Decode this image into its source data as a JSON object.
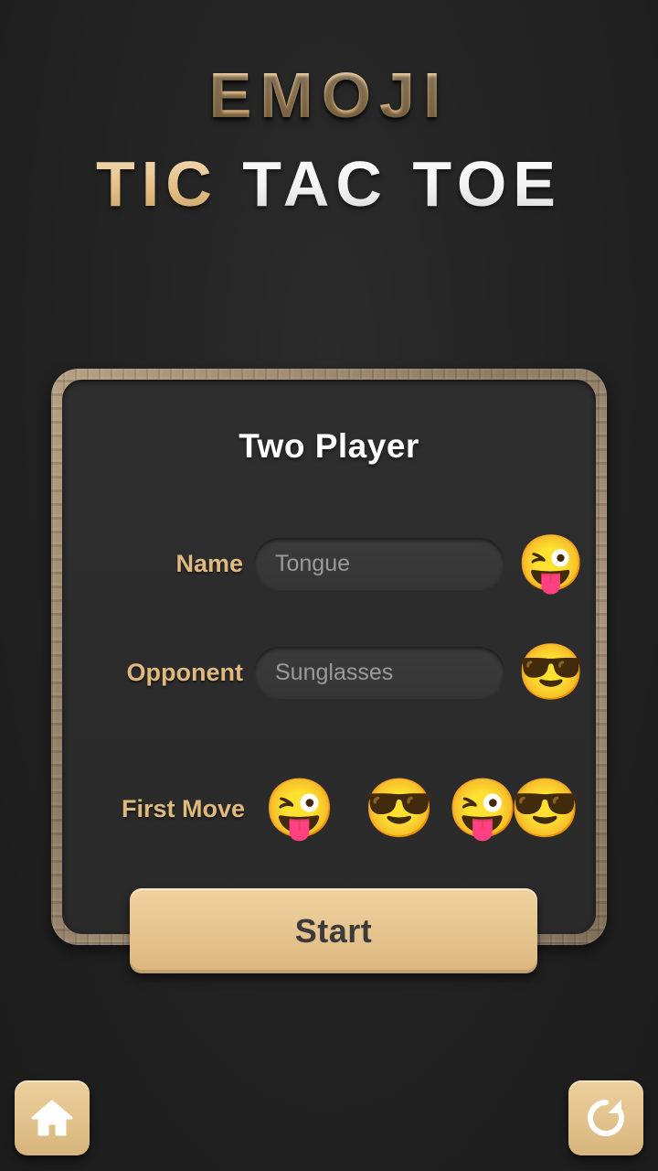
{
  "title": {
    "line1": "EMOJI",
    "line2_words": [
      "TIC",
      "TAC",
      "TOE"
    ]
  },
  "panel": {
    "heading": "Two Player",
    "fields": [
      {
        "label": "Name",
        "value": "Tongue",
        "avatar": "winking-face-with-tongue-emoji",
        "avatar_glyph": "😜"
      },
      {
        "label": "Opponent",
        "value": "Sunglasses",
        "avatar": "smiling-face-with-sunglasses-emoji",
        "avatar_glyph": "😎"
      }
    ],
    "first_move": {
      "label": "First Move",
      "options": [
        {
          "name": "first-move-tongue",
          "glyphs": [
            "😜"
          ]
        },
        {
          "name": "first-move-sunglasses",
          "glyphs": [
            "😎"
          ]
        },
        {
          "name": "first-move-random",
          "glyphs": [
            "😜",
            "😎"
          ]
        }
      ]
    },
    "start_label": "Start"
  },
  "footer": {
    "home_icon": "home-icon",
    "restart_icon": "restart-icon"
  },
  "colors": {
    "gold": "#e3bf86",
    "label_gold": "#e0b97f",
    "background": "#222222",
    "panel": "#2e2e2e",
    "button": "#e7c591"
  }
}
